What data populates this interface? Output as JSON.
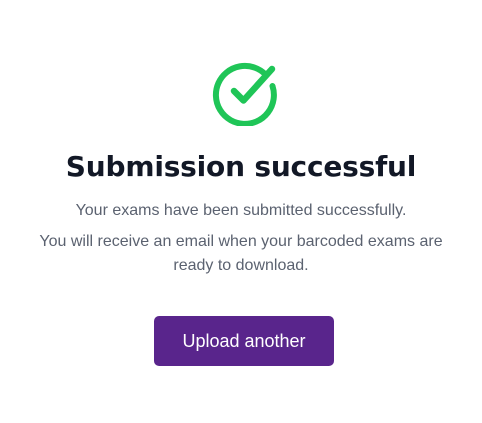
{
  "status": {
    "title": "Submission successful",
    "message_line_1": "Your exams have been submitted successfully.",
    "message_line_2": "You will receive an email when your barcoded exams are",
    "message_line_3": "ready to download.",
    "icon": "check-circle-icon",
    "icon_color": "#1fc557"
  },
  "actions": {
    "upload_another_label": "Upload another",
    "button_color": "#59258c"
  }
}
